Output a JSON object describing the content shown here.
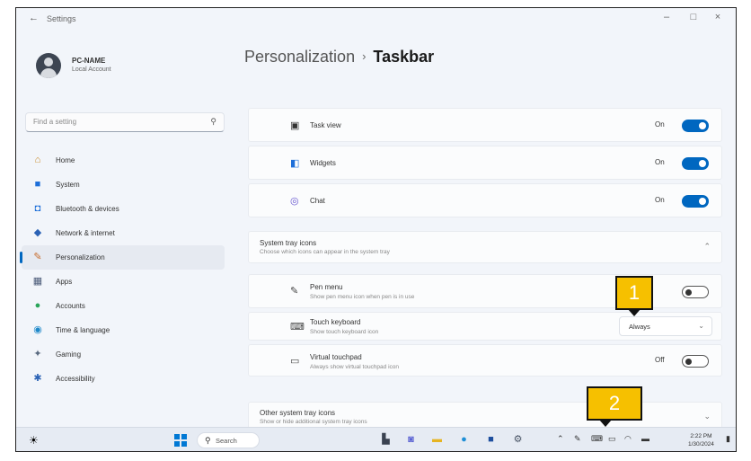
{
  "window": {
    "title": "Settings",
    "back": "←",
    "minimize": "–",
    "maximize": "□",
    "close": "×"
  },
  "profile": {
    "name": "PC-NAME",
    "subtitle": "Local Account"
  },
  "search": {
    "placeholder": "Find a setting"
  },
  "nav": [
    {
      "label": "Home",
      "icon": "home-icon",
      "glyph": "⌂",
      "color": "#c98b2a"
    },
    {
      "label": "System",
      "icon": "system-icon",
      "glyph": "■",
      "color": "#1e6fd9"
    },
    {
      "label": "Bluetooth & devices",
      "icon": "bluetooth-icon",
      "glyph": "◘",
      "color": "#1e6fd9"
    },
    {
      "label": "Network & internet",
      "icon": "network-icon",
      "glyph": "◆",
      "color": "#2b62b5"
    },
    {
      "label": "Personalization",
      "icon": "brush-icon",
      "glyph": "✎",
      "color": "#c76b2b",
      "active": true
    },
    {
      "label": "Apps",
      "icon": "apps-icon",
      "glyph": "▦",
      "color": "#4a5a78"
    },
    {
      "label": "Accounts",
      "icon": "accounts-icon",
      "glyph": "●",
      "color": "#2aa55a"
    },
    {
      "label": "Time & language",
      "icon": "globe-icon",
      "glyph": "◉",
      "color": "#1e88c9"
    },
    {
      "label": "Gaming",
      "icon": "gaming-icon",
      "glyph": "✦",
      "color": "#5a6a80"
    },
    {
      "label": "Accessibility",
      "icon": "accessibility-icon",
      "glyph": "✱",
      "color": "#2b62b5"
    }
  ],
  "breadcrumb": {
    "parent": "Personalization",
    "separator": "›",
    "current": "Taskbar"
  },
  "taskbar_items": [
    {
      "label": "Task view",
      "state": "On",
      "icon": "task-view-icon",
      "glyph": "▣",
      "color": "#333333"
    },
    {
      "label": "Widgets",
      "state": "On",
      "icon": "widgets-icon",
      "glyph": "◧",
      "color": "#1e6fd9"
    },
    {
      "label": "Chat",
      "state": "On",
      "icon": "chat-icon",
      "glyph": "◎",
      "color": "#6a5ad1"
    }
  ],
  "system_tray": {
    "title": "System tray icons",
    "subtitle": "Choose which icons can appear in the system tray",
    "chevron": "⌃",
    "pen_menu": {
      "title": "Pen menu",
      "subtitle": "Show pen menu icon when pen is in use",
      "glyph": "✎"
    },
    "touch_keyboard": {
      "title": "Touch keyboard",
      "subtitle": "Show touch keyboard icon",
      "value": "Always",
      "glyph": "⌨"
    },
    "virtual_touchpad": {
      "title": "Virtual touchpad",
      "subtitle": "Always show virtual touchpad icon",
      "state": "Off",
      "glyph": "▭"
    }
  },
  "other_tray": {
    "title": "Other system tray icons",
    "subtitle": "Show or hide additional system tray icons",
    "chevron": "⌄"
  },
  "taskbar": {
    "search_label": "Search",
    "clock_time": "2:22 PM",
    "clock_date": "1/30/2024",
    "apps": [
      {
        "icon": "file-explorer-icon",
        "glyph": "▙",
        "color": "#3a4250"
      },
      {
        "icon": "chat-app-icon",
        "glyph": "◙",
        "color": "#5b63d3"
      },
      {
        "icon": "folder-icon",
        "glyph": "▬",
        "color": "#e6b422"
      },
      {
        "icon": "edge-icon",
        "glyph": "●",
        "color": "#1f8fd6"
      },
      {
        "icon": "store-icon",
        "glyph": "■",
        "color": "#1e4f9e"
      },
      {
        "icon": "settings-icon",
        "glyph": "⚙",
        "color": "#4a5566"
      }
    ],
    "tray": [
      {
        "icon": "chevron-up-icon",
        "glyph": "⌃"
      },
      {
        "icon": "pen-tray-icon",
        "glyph": "✎"
      },
      {
        "icon": "keyboard-tray-icon",
        "glyph": "⌨"
      },
      {
        "icon": "touchpad-tray-icon",
        "glyph": "▭"
      },
      {
        "icon": "network-tray-icon",
        "glyph": "◠"
      },
      {
        "icon": "battery-icon",
        "glyph": "▬"
      }
    ]
  },
  "annotations": [
    {
      "label": "1"
    },
    {
      "label": "2"
    }
  ]
}
